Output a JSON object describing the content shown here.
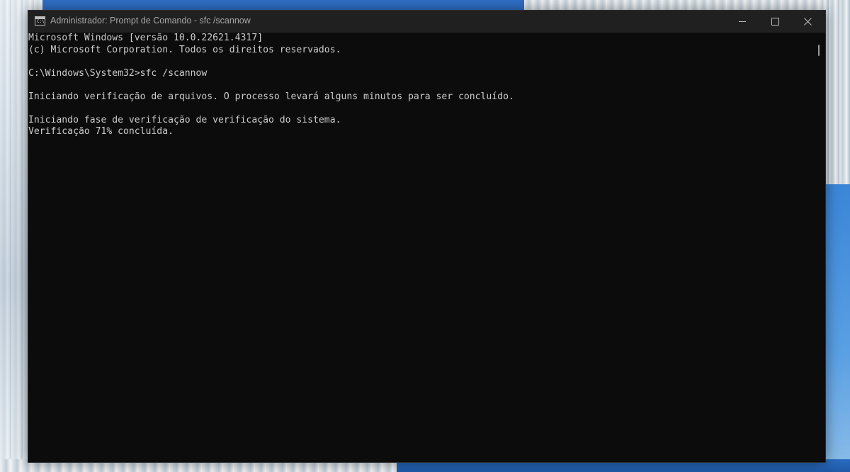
{
  "window": {
    "title": "Administrador: Prompt de Comando - sfc  /scannow",
    "icon": "cmd-icon",
    "controls": {
      "minimize": "minimize-icon",
      "maximize": "maximize-icon",
      "close": "close-icon"
    }
  },
  "console": {
    "text_color": "#cccccc",
    "background": "#0c0c0c",
    "lines": [
      "Microsoft Windows [versão 10.0.22621.4317]",
      "(c) Microsoft Corporation. Todos os direitos reservados.",
      "",
      "C:\\Windows\\System32>sfc /scannow",
      "",
      "Iniciando verificação de arquivos. O processo levará alguns minutos para ser concluído.",
      "",
      "Iniciando fase de verificação de verificação do sistema.",
      "Verificação 71% concluída."
    ]
  }
}
